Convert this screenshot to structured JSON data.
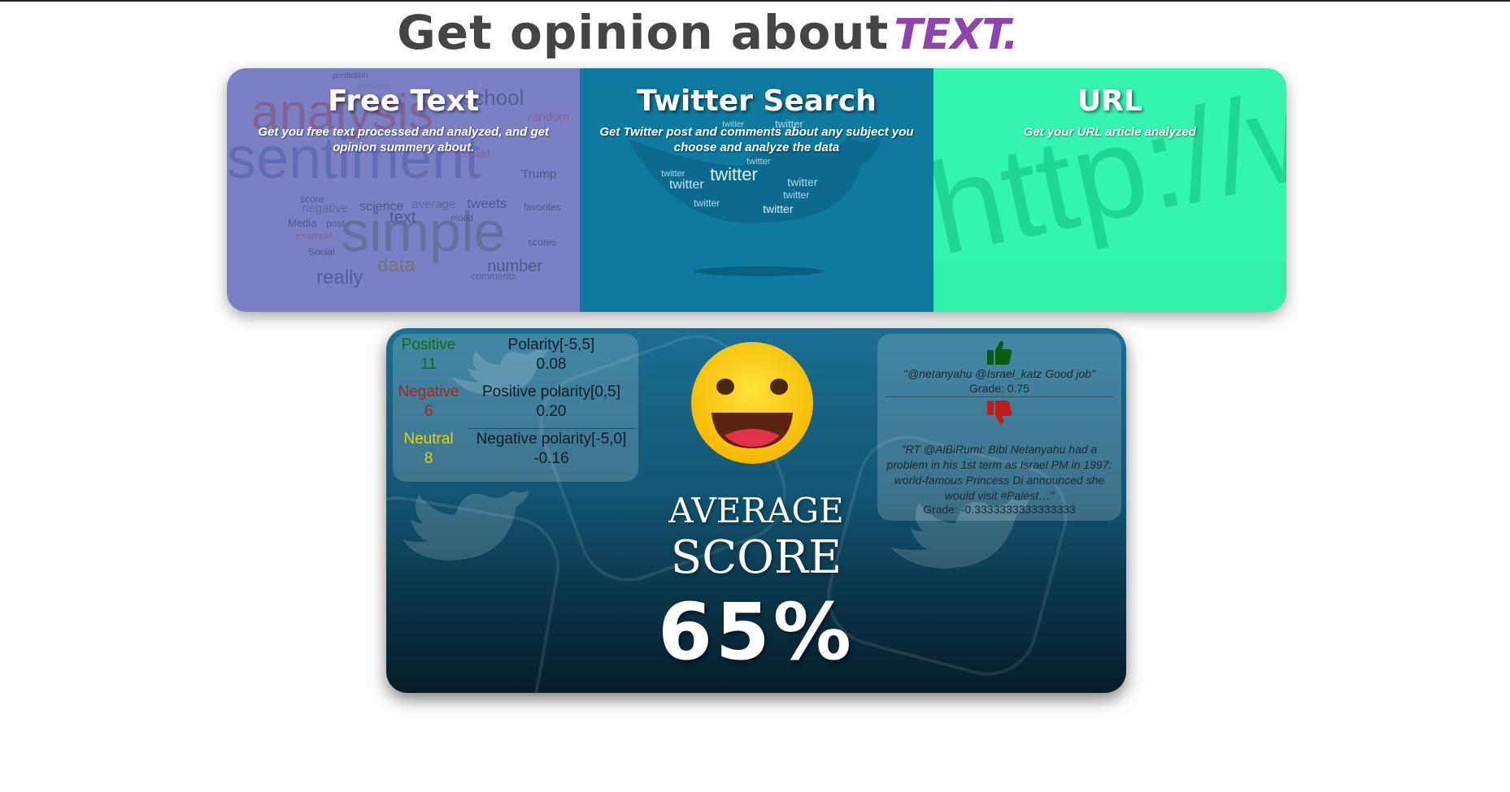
{
  "header": {
    "title_main": "Get opinion about",
    "title_accent": "TEXT."
  },
  "cards": [
    {
      "title": "Free Text",
      "description": "Get you free text processed and analyzed, and get opinion summery about.",
      "color": "#7b80c4"
    },
    {
      "title": "Twitter Search",
      "description": "Get Twitter post and comments about any subject you choose and analyze the data",
      "color": "#0e7aa0"
    },
    {
      "title": "URL",
      "description": "Get your URL article analyzed",
      "color": "#33f5b0"
    }
  ],
  "wordcloud": [
    "analysis",
    "sentiment",
    "simple",
    "school",
    "text",
    "Trump",
    "tweets",
    "number",
    "data",
    "really",
    "science",
    "negative",
    "average",
    "score",
    "Media",
    "post",
    "example",
    "Social",
    "positive",
    "prediction",
    "random",
    "comments",
    "favorites",
    "mood",
    "Donald",
    "scores"
  ],
  "twitter_cloud": [
    "twitter",
    "twitter",
    "twitter",
    "twitter",
    "twitter",
    "twitter",
    "twitter",
    "twitter",
    "twitter",
    "twitter"
  ],
  "url_bg_text": "http://www",
  "stats": {
    "positive_label": "Positive",
    "positive_value": "11",
    "negative_label": "Negative",
    "negative_value": "6",
    "neutral_label": "Neutral",
    "neutral_value": "8",
    "polarity_label": "Polarity[-5,5]",
    "polarity_value": "0.08",
    "pos_polarity_label": "Positive polarity[0,5]",
    "pos_polarity_value": "0.20",
    "neg_polarity_label": "Negative polarity[-5,0]",
    "neg_polarity_value": "-0.16",
    "colors": {
      "positive": "#0a6e17",
      "negative": "#b02020",
      "neutral": "#e5d40a"
    }
  },
  "score": {
    "line1": "AVERAGE",
    "line2": "SCORE",
    "percent": "65%",
    "emoji": "grinning-face-icon"
  },
  "tweets": {
    "positive_icon": "thumbs-up-icon",
    "positive_text": "\"@netanyahu @Israel_katz Good job\"",
    "positive_grade": "Grade: 0.75",
    "negative_icon": "thumbs-down-icon",
    "negative_text": "\"RT @AlBiRumi: Bibi Netanyahu had a problem in his 1st term as Israel PM in 1997: world-famous Princess Di announced she would visit #Palest…\"",
    "negative_grade": "Grade: -0.3333333333333333"
  }
}
